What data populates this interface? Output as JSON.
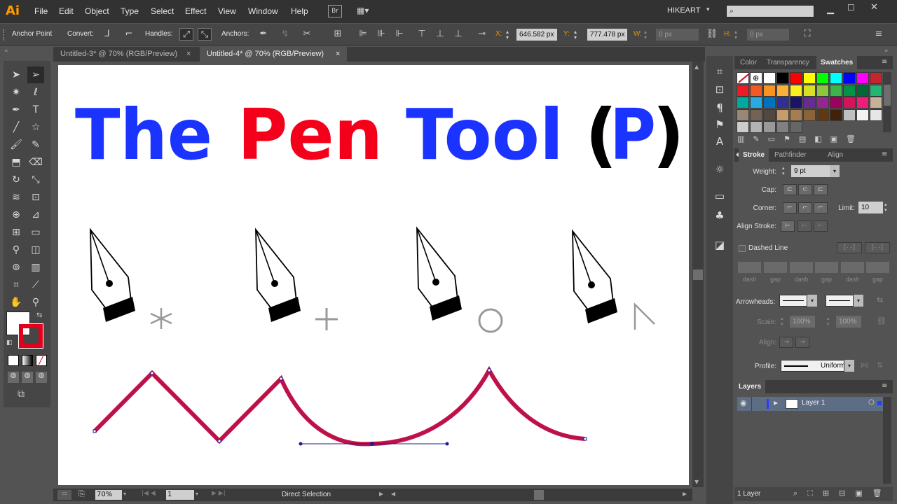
{
  "app": {
    "logo": "Ai",
    "menu": [
      "File",
      "Edit",
      "Object",
      "Type",
      "Select",
      "Effect",
      "View",
      "Window",
      "Help"
    ],
    "bridge_label": "Br",
    "workspace": "HIKEART",
    "search_placeholder": ""
  },
  "control_bar": {
    "anchor_point": "Anchor Point",
    "convert": "Convert:",
    "handles": "Handles:",
    "anchors": "Anchors:",
    "x_label": "X:",
    "x_value": "646.582 px",
    "y_label": "Y:",
    "y_value": "777.478 px",
    "w_label": "W:",
    "w_value": "0 px",
    "h_label": "H:",
    "h_value": "0 px"
  },
  "tabs": [
    {
      "label": "Untitled-3* @ 70% (RGB/Preview)",
      "close": "×"
    },
    {
      "label": "Untitled-4* @ 70% (RGB/Preview)",
      "close": "×"
    }
  ],
  "artboard": {
    "title_words": [
      {
        "text": "The",
        "color": "#1a33ff"
      },
      {
        "text": "Pen",
        "color": "#f5001a"
      },
      {
        "text": "Tool",
        "color": "#1a33ff"
      }
    ],
    "shortcut_open": "(",
    "shortcut_key": "P",
    "shortcut_close": ")",
    "shortcut_color": "#1a33ff",
    "path_color": "#c8103f"
  },
  "status": {
    "zoom": "70%",
    "page": "1",
    "tool": "Direct Selection"
  },
  "color_panel": {
    "tabs": [
      "Color",
      "Transparency",
      "Swatches"
    ],
    "swatches": [
      "#ffffff",
      "#000000",
      "#ff0000",
      "#ffff00",
      "#00ff00",
      "#00ffff",
      "#0000ff",
      "#ff00ff",
      "#c1272d",
      "#ed1c24",
      "#f15a24",
      "#f7931e",
      "#fbb03b",
      "#fcee21",
      "#d9e021",
      "#8cc63f",
      "#39b54a",
      "#009245",
      "#006837",
      "#22b573",
      "#00a99d",
      "#29abe2",
      "#0071bc",
      "#2e3192",
      "#1b1464",
      "#662d91",
      "#93278f",
      "#9e005d",
      "#d4145a",
      "#ed1e79",
      "#c7b299",
      "#998675",
      "#736357",
      "#534741",
      "#c69c6d",
      "#a67c52",
      "#8c6239",
      "#603813",
      "#42210b",
      "#c0c0c0",
      "#f2f2f2",
      "#e6e6e6",
      "#cccccc",
      "#b3b3b3",
      "#999999",
      "#808080",
      "#666666"
    ]
  },
  "stroke_panel": {
    "tabs": [
      "Stroke",
      "Pathfinder",
      "Align"
    ],
    "weight_label": "Weight:",
    "weight_value": "9 pt",
    "cap_label": "Cap:",
    "corner_label": "Corner:",
    "limit_label": "Limit:",
    "limit_value": "10",
    "align_label": "Align Stroke:",
    "dashed_label": "Dashed Line",
    "dash_labels": [
      "dash",
      "gap",
      "dash",
      "gap",
      "dash",
      "gap"
    ],
    "arrowheads_label": "Arrowheads:",
    "scale_label": "Scale:",
    "scale_start": "100%",
    "scale_end": "100%",
    "align2_label": "Align:",
    "profile_label": "Profile:",
    "profile_value": "Uniform"
  },
  "layers_panel": {
    "title": "Layers",
    "layer_name": "Layer 1",
    "count": "1 Layer"
  }
}
